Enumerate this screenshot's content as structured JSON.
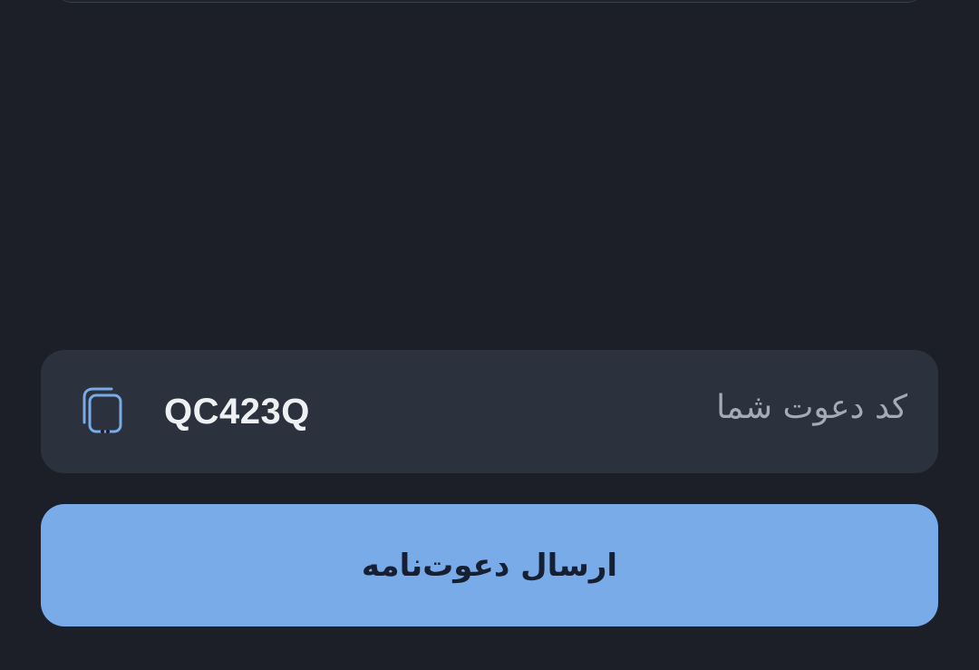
{
  "invite": {
    "label": "کد دعوت شما",
    "code": "QC423Q",
    "copy_icon": "copy-icon"
  },
  "actions": {
    "send_invite_label": "ارسال دعوت‌نامه"
  },
  "colors": {
    "background": "#1c1f28",
    "card": "#2b313d",
    "accent": "#78abe8",
    "icon": "#78abe8"
  }
}
